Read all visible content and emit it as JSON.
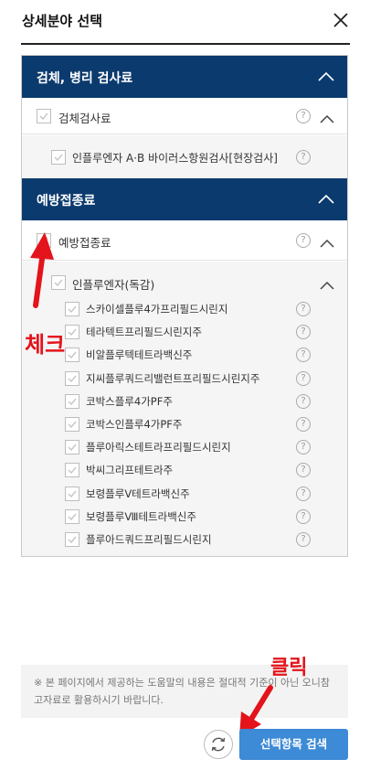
{
  "header": {
    "title": "상세분야 선택"
  },
  "sections": [
    {
      "title": "검체, 병리 검사료",
      "row": {
        "label": "검체검사료"
      },
      "sub": {
        "label": "인플루엔자 A·B 바이러스항원검사[현장검사]"
      }
    },
    {
      "title": "예방접종료",
      "row": {
        "label": "예방접종료"
      },
      "sub": {
        "label": "인플루엔자(독감)"
      },
      "items": [
        "스카이셀플루4가프리필드시린지",
        "테라텍트프리필드시린지주",
        "비알플루텍테트라백신주",
        "지씨플루쿼드리밸런트프리필드시린지주",
        "코박스플루4가PF주",
        "코박스인플루4가PF주",
        "플루아릭스테트라프리필드시린지",
        "박씨그리프테트라주",
        "보령플루Ⅴ테트라백신주",
        "보령플루Ⅷ테트라백신주",
        "플루아드쿼드프리필드시린지"
      ]
    }
  ],
  "help_symbol": "?",
  "note": "※ 본 페이지에서 제공하는 도움말의 내용은 절대적 기준이 아닌 오니참고자료로 활용하시기 바랍니다.",
  "buttons": {
    "search": "선택항목 검색"
  },
  "annotations": {
    "check": "체크",
    "click": "클릭"
  },
  "colors": {
    "section_header": "#0b3a6e",
    "button": "#3d8ad6",
    "annotation": "#e3141b"
  }
}
